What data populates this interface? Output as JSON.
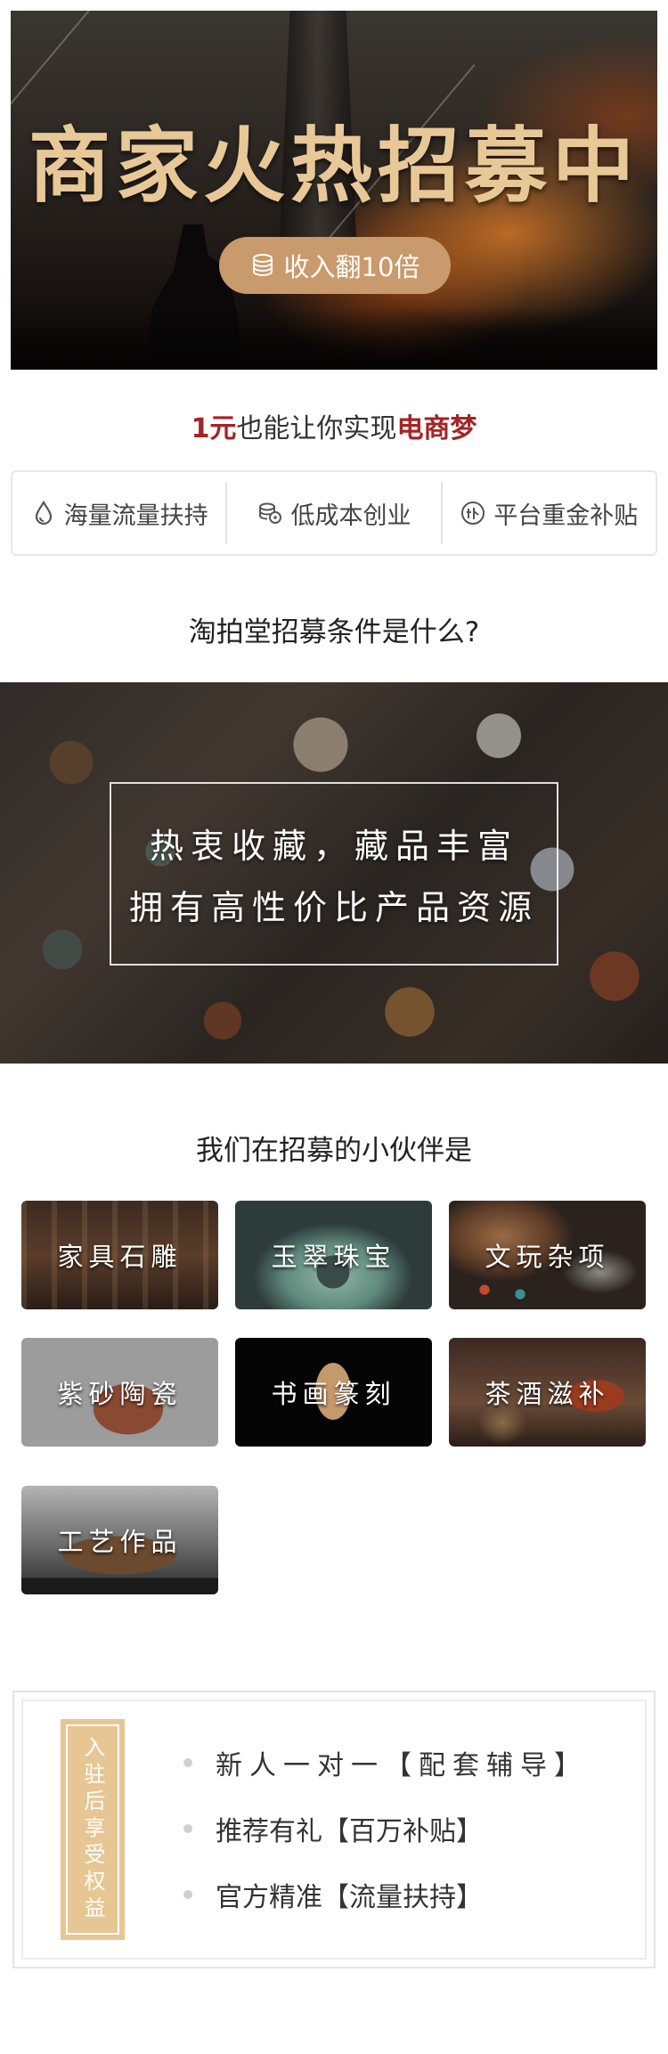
{
  "hero": {
    "title": "商家火热招募中",
    "pill_label": "收入翻10倍",
    "pill_icon": "coin-stack-icon",
    "accent": "#c99a6b",
    "title_color": "#e8c897"
  },
  "slogan": {
    "prefix": "1元",
    "middle": "也能让你实现",
    "suffix": "电商梦",
    "highlight_color": "#a42325"
  },
  "features": [
    {
      "icon": "drop-icon",
      "label": "海量流量扶持"
    },
    {
      "icon": "coins-icon",
      "label": "低成本创业"
    },
    {
      "icon": "subsidy-badge-icon",
      "label": "平台重金补贴"
    }
  ],
  "conditions": {
    "title": "淘拍堂招募条件是什么?",
    "line1": "热衷收藏，藏品丰富",
    "line2": "拥有高性价比产品资源"
  },
  "partners": {
    "title": "我们在招募的小伙伴是",
    "items": [
      {
        "label": "家具石雕"
      },
      {
        "label": "玉翠珠宝"
      },
      {
        "label": "文玩杂项"
      },
      {
        "label": "紫砂陶瓷"
      },
      {
        "label": "书画篆刻"
      },
      {
        "label": "茶酒滋补"
      },
      {
        "label": "工艺作品"
      }
    ]
  },
  "benefits": {
    "badge": "入驻后享受权益",
    "items": [
      {
        "label": "新人一对一【配套辅导】"
      },
      {
        "label": "推荐有礼【百万补贴】"
      },
      {
        "label": "官方精准【流量扶持】"
      }
    ],
    "badge_color": "#e6c693"
  }
}
